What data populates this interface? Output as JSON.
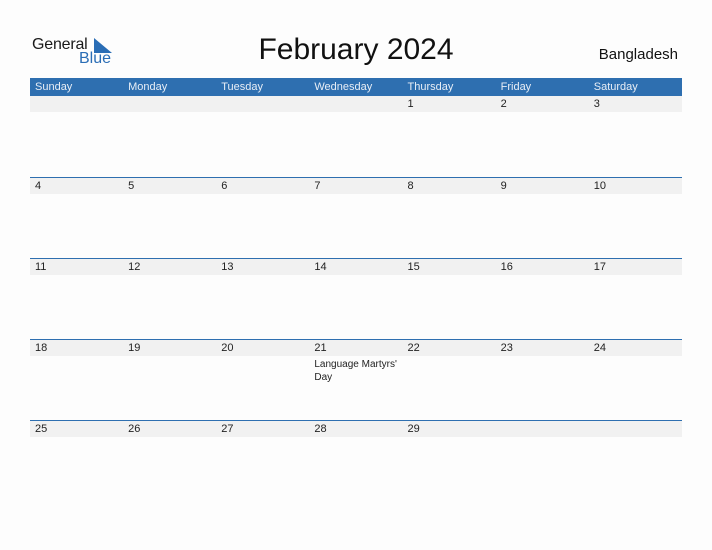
{
  "logo": {
    "line1": "General",
    "line2": "Blue"
  },
  "title": "February 2024",
  "country": "Bangladesh",
  "weekdays": [
    "Sunday",
    "Monday",
    "Tuesday",
    "Wednesday",
    "Thursday",
    "Friday",
    "Saturday"
  ],
  "weeks": [
    {
      "days": [
        "",
        "",
        "",
        "",
        "1",
        "2",
        "3"
      ],
      "events": [
        "",
        "",
        "",
        "",
        "",
        "",
        ""
      ]
    },
    {
      "days": [
        "4",
        "5",
        "6",
        "7",
        "8",
        "9",
        "10"
      ],
      "events": [
        "",
        "",
        "",
        "",
        "",
        "",
        ""
      ]
    },
    {
      "days": [
        "11",
        "12",
        "13",
        "14",
        "15",
        "16",
        "17"
      ],
      "events": [
        "",
        "",
        "",
        "",
        "",
        "",
        ""
      ]
    },
    {
      "days": [
        "18",
        "19",
        "20",
        "21",
        "22",
        "23",
        "24"
      ],
      "events": [
        "",
        "",
        "",
        "Language Martyrs' Day",
        "",
        "",
        ""
      ]
    },
    {
      "days": [
        "25",
        "26",
        "27",
        "28",
        "29",
        "",
        ""
      ],
      "events": [
        "",
        "",
        "",
        "",
        "",
        "",
        ""
      ]
    }
  ],
  "colors": {
    "accent": "#2e6fb0",
    "row_bg": "#f1f1f1"
  }
}
